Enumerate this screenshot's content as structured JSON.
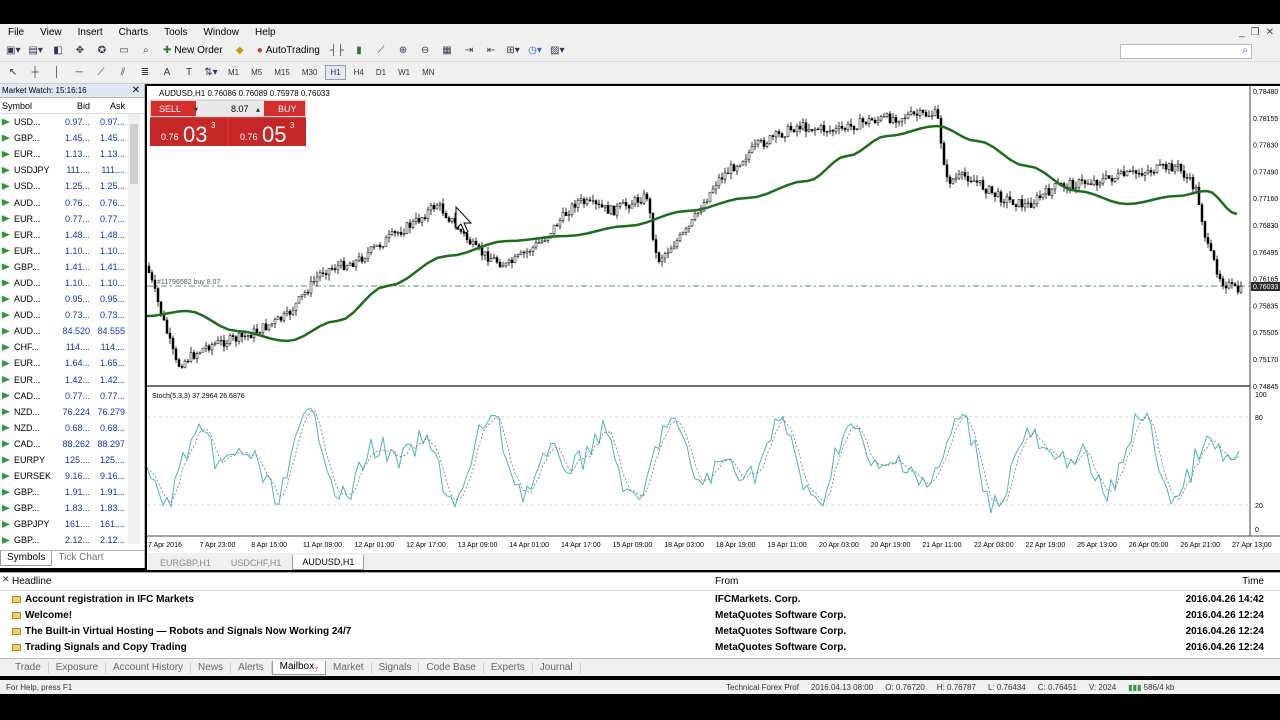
{
  "menu": [
    "File",
    "View",
    "Insert",
    "Charts",
    "Tools",
    "Window",
    "Help"
  ],
  "toolbar": {
    "new_order": "New Order",
    "autotrading": "AutoTrading"
  },
  "timeframes": [
    "M1",
    "M5",
    "M15",
    "M30",
    "H1",
    "H4",
    "D1",
    "W1",
    "MN"
  ],
  "market_watch": {
    "title": "Market Watch: 15:16:16",
    "columns": [
      "Symbol",
      "Bid",
      "Ask"
    ],
    "rows": [
      {
        "symbol": "USD...",
        "bid": "0.97...",
        "ask": "0.97..."
      },
      {
        "symbol": "GBP...",
        "bid": "1.45...",
        "ask": "1.45..."
      },
      {
        "symbol": "EUR...",
        "bid": "1.13...",
        "ask": "1.13..."
      },
      {
        "symbol": "USDJPY",
        "bid": "111....",
        "ask": "111...."
      },
      {
        "symbol": "USD...",
        "bid": "1.25...",
        "ask": "1.25..."
      },
      {
        "symbol": "AUD...",
        "bid": "0.76...",
        "ask": "0.76..."
      },
      {
        "symbol": "EUR...",
        "bid": "0.77...",
        "ask": "0.77..."
      },
      {
        "symbol": "EUR...",
        "bid": "1.48...",
        "ask": "1.48..."
      },
      {
        "symbol": "EUR...",
        "bid": "1.10...",
        "ask": "1.10..."
      },
      {
        "symbol": "GBP...",
        "bid": "1.41...",
        "ask": "1.41..."
      },
      {
        "symbol": "AUD...",
        "bid": "1.10...",
        "ask": "1.10..."
      },
      {
        "symbol": "AUD...",
        "bid": "0.95...",
        "ask": "0.95..."
      },
      {
        "symbol": "AUD...",
        "bid": "0.73...",
        "ask": "0.73..."
      },
      {
        "symbol": "AUD...",
        "bid": "84.520",
        "ask": "84.555"
      },
      {
        "symbol": "CHF...",
        "bid": "114....",
        "ask": "114...."
      },
      {
        "symbol": "EUR...",
        "bid": "1.64...",
        "ask": "1.65..."
      },
      {
        "symbol": "EUR...",
        "bid": "1.42...",
        "ask": "1.42..."
      },
      {
        "symbol": "CAD...",
        "bid": "0.77...",
        "ask": "0.77..."
      },
      {
        "symbol": "NZD...",
        "bid": "76.224",
        "ask": "76.279"
      },
      {
        "symbol": "NZD...",
        "bid": "0.68...",
        "ask": "0.68..."
      },
      {
        "symbol": "CAD...",
        "bid": "88.262",
        "ask": "88.297"
      },
      {
        "symbol": "EURPY",
        "bid": "125....",
        "ask": "125...."
      },
      {
        "symbol": "EURSEK",
        "bid": "9.16...",
        "ask": "9.16..."
      },
      {
        "symbol": "GBP...",
        "bid": "1.91...",
        "ask": "1.91..."
      },
      {
        "symbol": "GBP...",
        "bid": "1.83...",
        "ask": "1.83..."
      },
      {
        "symbol": "GBPJPY",
        "bid": "161....",
        "ask": "161...."
      },
      {
        "symbol": "GBP...",
        "bid": "2.12...",
        "ask": "2.12..."
      }
    ],
    "tabs": [
      "Symbols",
      "Tick Chart"
    ]
  },
  "chart": {
    "title": "AUDUSD,H1  0.76086 0.76089 0.75978 0.76033",
    "sell_label": "SELL",
    "buy_label": "BUY",
    "lot": "8.07",
    "sell_price_small": "0.76",
    "sell_price_big": "03",
    "sell_price_sup": "3",
    "buy_price_small": "0.76",
    "buy_price_big": "05",
    "buy_price_sup": "3",
    "order_line_label": "#11796582 buy 8.07",
    "price_axis": [
      "0.78480",
      "0.78155",
      "0.77830",
      "0.77490",
      "0.77160",
      "0.76830",
      "0.76495",
      "0.76165",
      "0.75835",
      "0.75505",
      "0.75170",
      "0.74845"
    ],
    "current_price": "0.76033",
    "stoch_label": "Stoch(5,3,3) 37.2964 26.6876",
    "stoch_axis": [
      "100",
      "80",
      "20",
      "0"
    ],
    "time_axis": [
      "7 Apr 2016",
      "7 Apr 23:00",
      "8 Apr 15:00",
      "11 Apr 09:00",
      "12 Apr 01:00",
      "12 Apr 17:00",
      "13 Apr 09:00",
      "14 Apr 01:00",
      "14 Apr 17:00",
      "15 Apr 09:00",
      "18 Apr 03:00",
      "18 Apr 19:00",
      "19 Apr 11:00",
      "20 Apr 03:00",
      "20 Apr 19:00",
      "21 Apr 11:00",
      "22 Apr 03:00",
      "22 Apr 19:00",
      "25 Apr 13:00",
      "26 Apr 05:00",
      "26 Apr 21:00",
      "27 Apr 13:00"
    ],
    "tabs": [
      "EURGBP,H1",
      "USDCHF,H1",
      "AUDUSD,H1"
    ]
  },
  "terminal": {
    "columns": [
      "Headline",
      "From",
      "Time"
    ],
    "rows": [
      {
        "headline": "Account registration in IFC Markets",
        "from": "IFCMarkets. Corp.",
        "time": "2016.04.26 14:42"
      },
      {
        "headline": "Welcome!",
        "from": "MetaQuotes Software Corp.",
        "time": "2016.04.26 12:24"
      },
      {
        "headline": "The Built-in Virtual Hosting — Robots and Signals Now Working 24/7",
        "from": "MetaQuotes Software Corp.",
        "time": "2016.04.26 12:24"
      },
      {
        "headline": "Trading Signals and Copy Trading",
        "from": "MetaQuotes Software Corp.",
        "time": "2016.04.26 12:24"
      }
    ],
    "tabs": [
      "Trade",
      "Exposure",
      "Account History",
      "News",
      "Alerts",
      "Mailbox",
      "Market",
      "Signals",
      "Code Base",
      "Experts",
      "Journal"
    ],
    "mailbox_count": "7"
  },
  "status": {
    "help": "For Help, press F1",
    "profile": "Technical Forex Prof",
    "datetime": "2016.04.13 08:00",
    "open": "O: 0.76720",
    "high": "H: 0.76787",
    "low": "L: 0.76434",
    "close": "C: 0.76451",
    "volume": "V: 2024",
    "traffic": "586/4 kb"
  }
}
